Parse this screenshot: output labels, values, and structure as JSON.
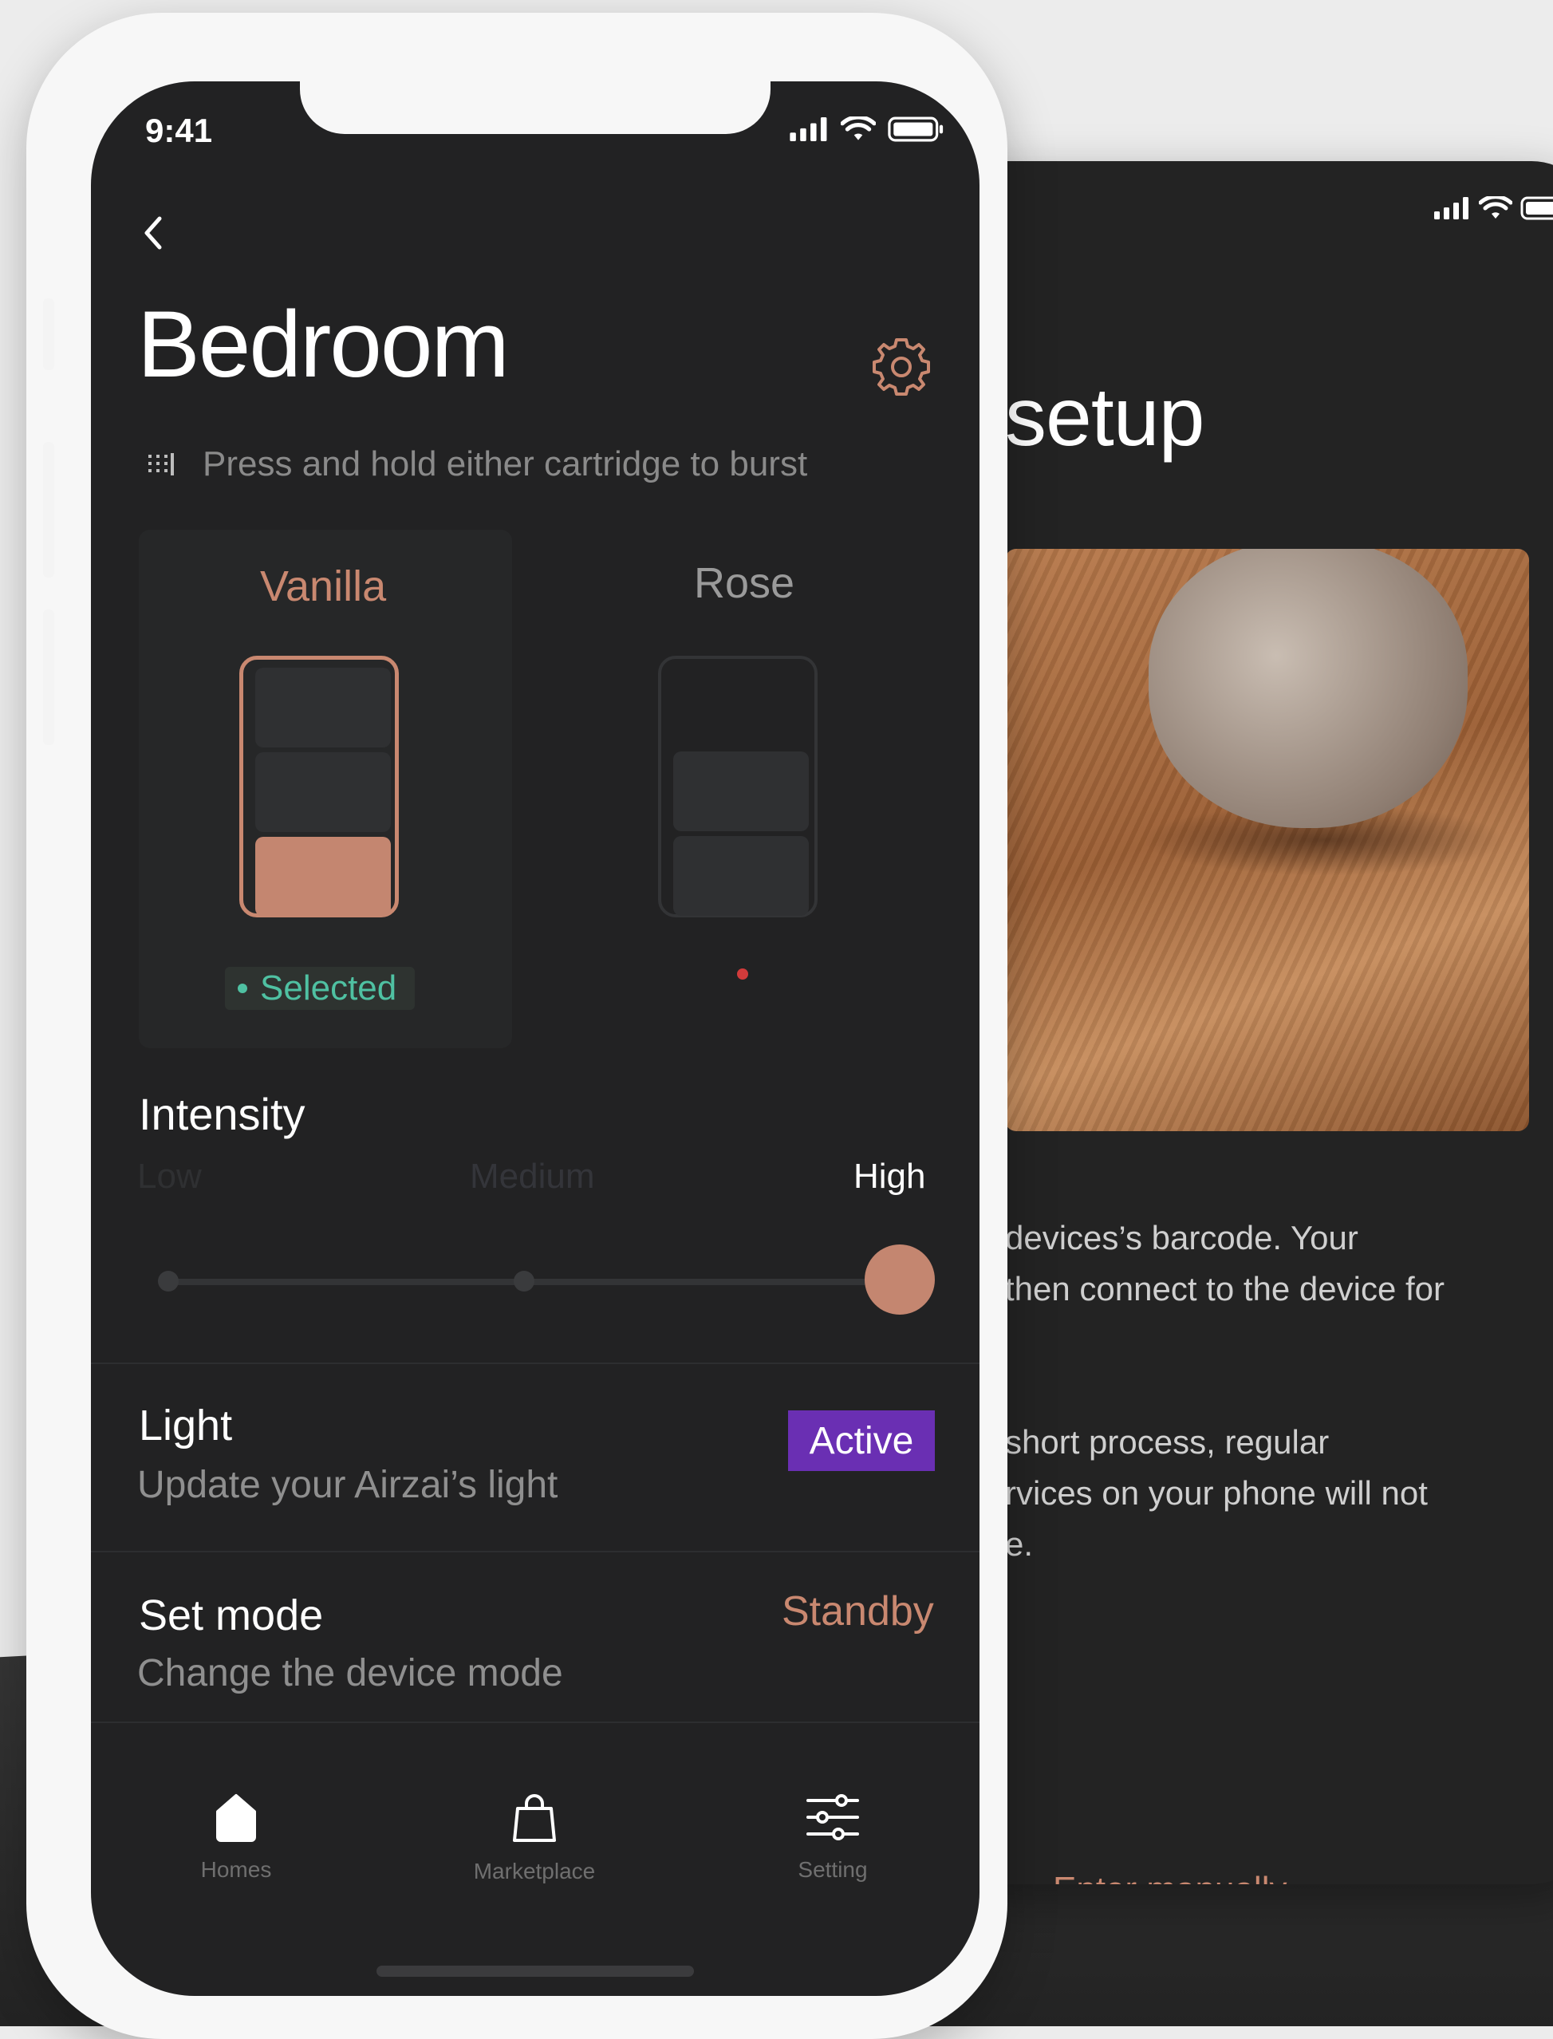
{
  "back_screen": {
    "title": "setup",
    "paragraph1": [
      "devices’s barcode. Your",
      "then connect to the device for"
    ],
    "paragraph2": [
      "short process, regular",
      "rvices on your phone will not",
      "e."
    ],
    "link_label": "Enter manually"
  },
  "front_screen": {
    "status": {
      "time": "9:41"
    },
    "title": "Bedroom",
    "hint": "Press and hold either cartridge to burst",
    "cartridges": [
      {
        "name": "Vanilla",
        "status": "Selected",
        "fill_level_segments": 1,
        "total_segments": 3
      },
      {
        "name": "Rose",
        "status": "",
        "fill_level_segments": 2,
        "total_segments": 3
      }
    ],
    "intensity": {
      "title": "Intensity",
      "levels": [
        "Low",
        "Medium",
        "High"
      ],
      "selected": "High"
    },
    "light": {
      "title": "Light",
      "subtitle": "Update your Airzai’s light",
      "badge": "Active"
    },
    "mode": {
      "title": "Set mode",
      "subtitle": "Change the device mode",
      "value": "Standby"
    },
    "bottom_nav": [
      {
        "label": "Homes",
        "icon": "home-icon"
      },
      {
        "label": "Marketplace",
        "icon": "bag-icon"
      },
      {
        "label": "Setting",
        "icon": "sliders-icon"
      }
    ]
  },
  "colors": {
    "accent": "#c98870",
    "selected_green": "#4fc1a2",
    "badge_purple": "#6a2fb3",
    "screen_bg": "#222223"
  }
}
